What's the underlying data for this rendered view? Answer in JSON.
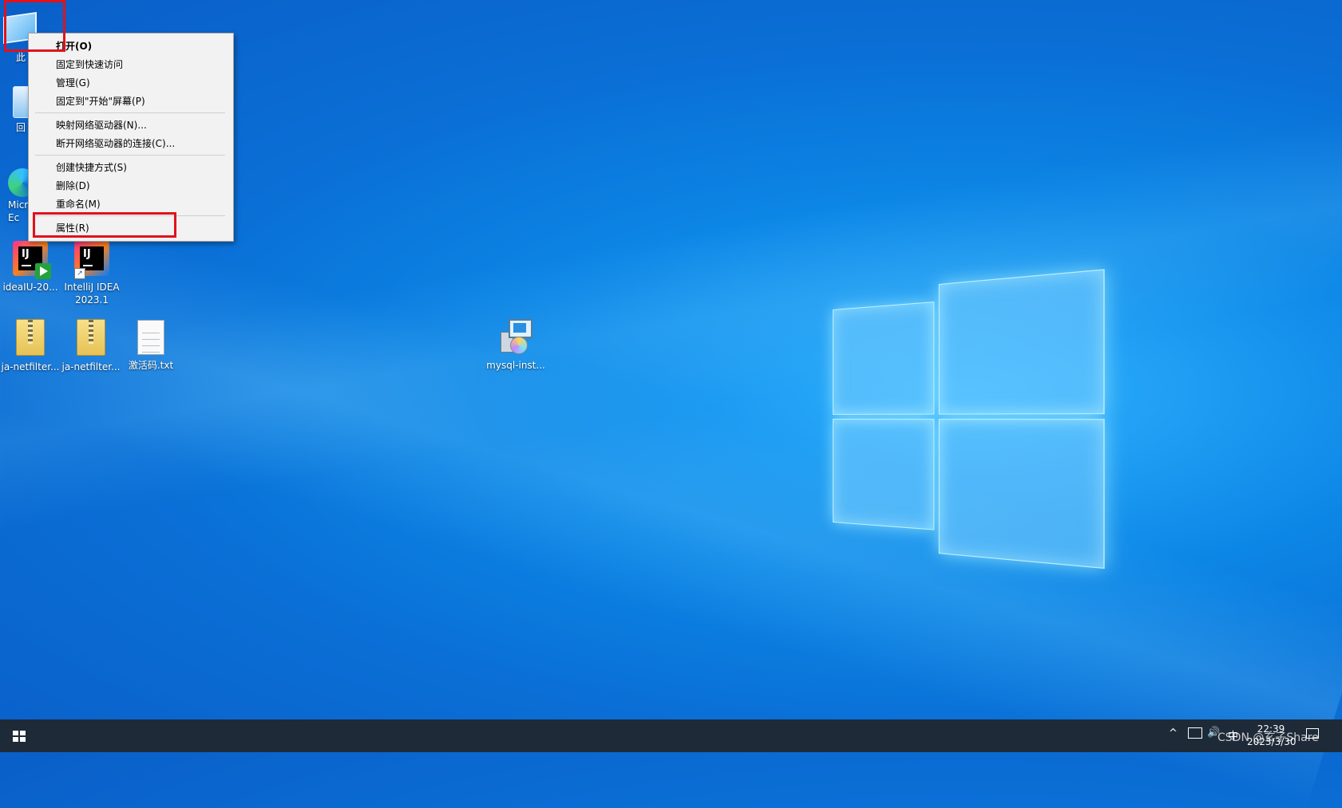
{
  "desktop": {
    "icons": [
      {
        "label": "此"
      },
      {
        "label": "回"
      },
      {
        "label": "Micr\nEc"
      },
      {
        "label": "ideaIU-20..."
      },
      {
        "label": "IntelliJ IDEA\n2023.1"
      },
      {
        "label": "ja-netfilter..."
      },
      {
        "label": "ja-netfilter..."
      },
      {
        "label": "激活码.txt"
      },
      {
        "label": "mysql-inst..."
      }
    ]
  },
  "context_menu": {
    "items": [
      {
        "label": "打开(O)",
        "bold": true
      },
      {
        "label": "固定到快速访问"
      },
      {
        "label": "管理(G)"
      },
      {
        "label": "固定到\"开始\"屏幕(P)"
      },
      {
        "label": "映射网络驱动器(N)..."
      },
      {
        "label": "断开网络驱动器的连接(C)..."
      },
      {
        "label": "创建快捷方式(S)"
      },
      {
        "label": "删除(D)"
      },
      {
        "label": "重命名(M)"
      },
      {
        "label": "属性(R)"
      }
    ],
    "highlighted_item": "属性(R)"
  },
  "taskbar": {
    "start_icon": "windows-logo-icon",
    "tray": {
      "chevron": "^",
      "language": "中",
      "time": "22:39",
      "date": "2023/3/30"
    }
  },
  "watermark": "CSDN @玄子Share",
  "colors": {
    "highlight_box": "#e0121b",
    "taskbar": "#1e2a38",
    "wallpaper_accent": "#0c86e6"
  }
}
